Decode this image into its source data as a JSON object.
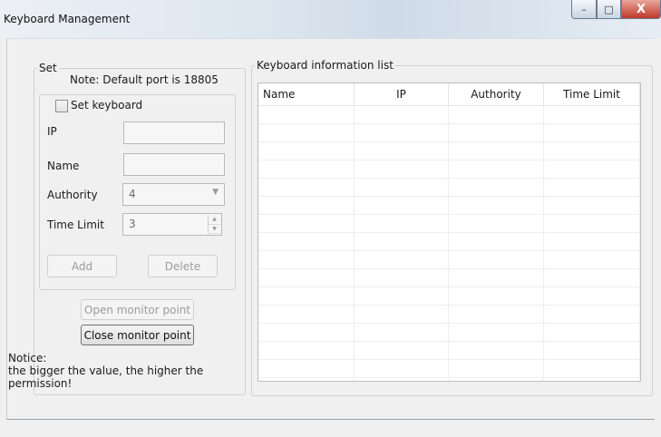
{
  "window": {
    "title": "Keyboard Management"
  },
  "titlebar_buttons": {
    "minimize": "–",
    "maximize": "□",
    "close": "X"
  },
  "set_group": {
    "legend": "Set",
    "note": "Note: Default port is 18805",
    "checkbox_label": "Set keyboard",
    "checked": false,
    "fields": {
      "ip_label": "IP",
      "ip_value": "",
      "name_label": "Name",
      "name_value": "",
      "authority_label": "Authority",
      "authority_value": "4",
      "time_limit_label": "Time Limit",
      "time_limit_value": "3"
    },
    "add_label": "Add",
    "delete_label": "Delete"
  },
  "open_monitor_label": "Open monitor point",
  "close_monitor_label": "Close monitor point",
  "notice": "Notice:\n the bigger the value, the higher the permission!",
  "list_group": {
    "legend": "Keyboard information list",
    "columns": [
      "Name",
      "IP",
      "Authority",
      "Time Limit"
    ],
    "rows": []
  },
  "icons": {
    "dropdown": "chevron-down-icon",
    "spin_up": "arrow-up-icon",
    "spin_down": "arrow-down-icon"
  }
}
